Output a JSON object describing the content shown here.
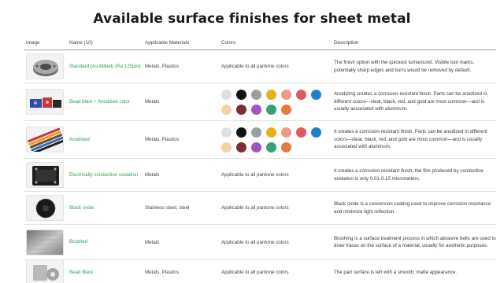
{
  "page": {
    "title": "Available surface finishes for sheet metal"
  },
  "table": {
    "headers": {
      "image": "Image",
      "name": "Name (10)",
      "materials": "Applicable Materials",
      "colors": "Colors",
      "description": "Description"
    },
    "rows": [
      {
        "thumb": "as-milled-part",
        "name": "Standard (As-Milled) (Ra 125μin)",
        "materials": "Metals, Plastics",
        "colors_text": "Applicable to all pantone colors",
        "description": "The finish option with the quickest turnaround. Visible tool marks, potentially sharp edges and burrs would be removed by default."
      },
      {
        "thumb": "bead-blast-anodized-part",
        "name": "Bead blast + Anodized color",
        "materials": "Metals",
        "swatches": [
          "#e0e0e0",
          "#111111",
          "#9e9e9e",
          "#e6b018",
          "#ee9a86",
          "#de5a60",
          "#1f80c9",
          "#f1d0aa",
          "#7c2d36",
          "#a055c5",
          "#35a275",
          "#e47a3e"
        ],
        "description": "Anodizing creates a corrosion-resistant finish. Parts can be anodized in different colors—clear, black, red, and gold are most common—and is usually associated with aluminum."
      },
      {
        "thumb": "anodized-tubes",
        "name": "Anodized",
        "materials": "Metals, Plastics",
        "swatches": [
          "#e0e0e0",
          "#111111",
          "#9e9e9e",
          "#e6b018",
          "#ee9a86",
          "#de5a60",
          "#1f80c9",
          "#f1d0aa",
          "#7c2d36",
          "#a055c5",
          "#35a275",
          "#e47a3e"
        ],
        "description": "It creates a corrosion-resistant finish. Parts can be anodized in different colors—clear, black, red, and gold are most common—and is usually associated with aluminum."
      },
      {
        "thumb": "conductive-oxidation-part",
        "name": "Electrically conductive oxidation",
        "materials": "Metals",
        "colors_text": "Applicable to all pantone colors",
        "description": "It creates a corrosion-resistant finish, the film produced by conductive oxidation is only 0.01-0.15 micrometers."
      },
      {
        "thumb": "black-oxide-heatsink",
        "name": "Black oxide",
        "materials": "Stainless steel, steel",
        "colors_text": "Applicable to all pantone colors",
        "description": "Black oxide is a conversion coating used to improve corrosion resistance and minimize light reflection."
      },
      {
        "thumb": "brushed-plate",
        "name": "Brushed",
        "materials": "Metals",
        "colors_text": "Applicable to all pantone colors",
        "description": "Brushing is a surface treatment process in which abrasive belts are used to draw traces on the surface of a material, usually for aesthetic purposes."
      },
      {
        "thumb": "bead-blast-part",
        "name": "Bead Blast",
        "materials": "Metals, Plastics",
        "colors_text": "Applicable to all pantone colors",
        "description": "The part surface is left with a smooth, matte appearance."
      }
    ]
  }
}
